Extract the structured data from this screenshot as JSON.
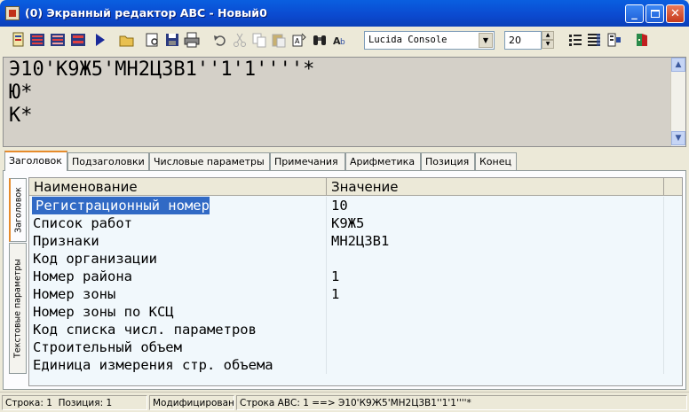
{
  "window": {
    "title": "(0) Экранный редактор ABC - Новый0"
  },
  "toolbar": {
    "icons": [
      "new-record-icon",
      "bars-red-icon",
      "bars-list-icon",
      "bars-grid-icon",
      "play-icon",
      "open-folder-icon",
      "print-preview-icon",
      "save-icon",
      "print-icon",
      "undo-icon",
      "cut-icon",
      "copy-icon",
      "paste-icon",
      "find-icon",
      "binoculars-icon",
      "font-size-icon",
      "list-icon",
      "list-detail-icon",
      "exit-icon"
    ],
    "font_name": "Lucida Console",
    "font_size": "20"
  },
  "editor": {
    "lines": [
      "Э10'К9Ж5'МН2Ц3В1''1'1''''*",
      "Ю*",
      "К*"
    ]
  },
  "tabs": [
    "Заголовок",
    "Подзаголовки",
    "Числовые параметры",
    "Примечания",
    "Арифметика",
    "Позиция",
    "Конец"
  ],
  "side_tabs": [
    "Заголовок",
    "Текстовые параметры"
  ],
  "table": {
    "headers": [
      "Наименование",
      "Значение"
    ],
    "rows": [
      {
        "name": "Регистрационный номер",
        "value": "10"
      },
      {
        "name": "Список работ",
        "value": "К9Ж5"
      },
      {
        "name": "Признаки",
        "value": "МН2Ц3В1"
      },
      {
        "name": "Код организации",
        "value": ""
      },
      {
        "name": "Номер района",
        "value": "1"
      },
      {
        "name": "Номер зоны",
        "value": "1"
      },
      {
        "name": "Номер зоны по КСЦ",
        "value": ""
      },
      {
        "name": "Код списка числ. параметров",
        "value": ""
      },
      {
        "name": "Строительный объем",
        "value": ""
      },
      {
        "name": "Единица измерения стр. объема",
        "value": ""
      }
    ]
  },
  "status": {
    "line": "Строка:  1",
    "position": "Позиция:  1",
    "state": "Модифицирован",
    "abc_line": "Строка АВС:  1 ==>  Э10'К9Ж5'МН2Ц3В1''1'1''''*"
  },
  "colors": {
    "titlebar": "#0b49cf",
    "selection": "#316ac5",
    "tab_accent": "#e68b2c",
    "grid_bg": "#f1f8fc"
  }
}
